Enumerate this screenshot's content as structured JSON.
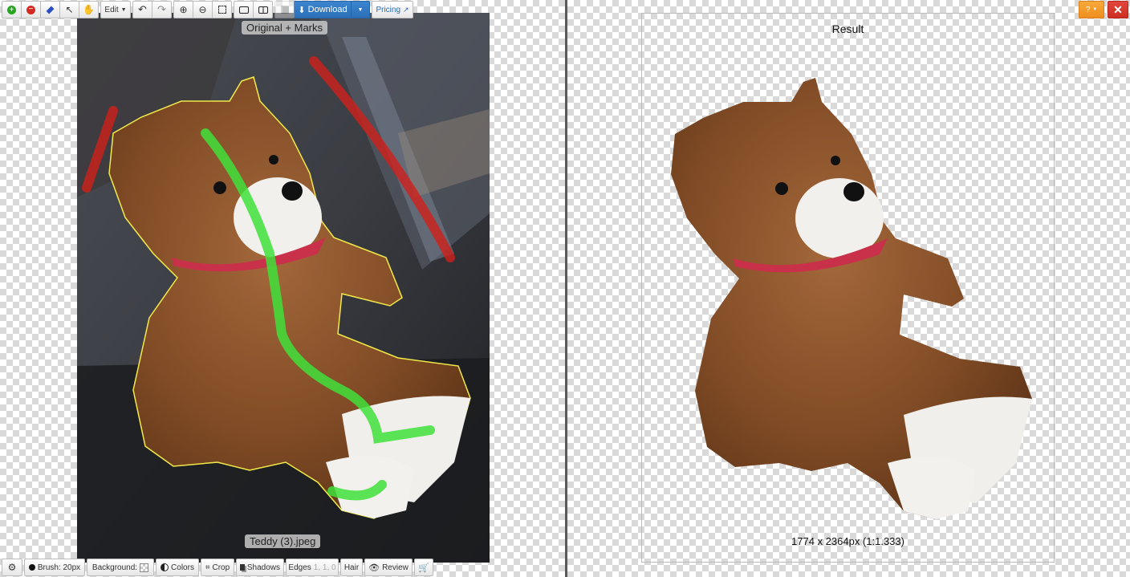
{
  "toolbar": {
    "edit_label": "Edit",
    "download_label": "Download",
    "pricing_label": "Pricing"
  },
  "left_view": {
    "caption_top": "Original + Marks",
    "caption_bottom": "Teddy (3).jpeg"
  },
  "right_view": {
    "title": "Result",
    "dimensions": "1774 x 2364px (1:1.333)"
  },
  "bottom_toolbar": {
    "brush_label": "Brush: 20px",
    "background_label": "Background:",
    "colors_label": "Colors",
    "crop_label": "Crop",
    "shadows_label": "Shadows",
    "edges_label": "Edges",
    "edges_values": "1, 1, 0",
    "hair_label": "Hair",
    "review_label": "Review"
  },
  "window": {
    "help_label": "?"
  },
  "colors": {
    "keep_mark": "#3fe03a",
    "remove_mark": "#d0201a",
    "outline": "#f2ea4a",
    "download_blue": "#2c6fb6",
    "help_orange": "#ef8e1f",
    "close_red": "#cc2e24"
  }
}
